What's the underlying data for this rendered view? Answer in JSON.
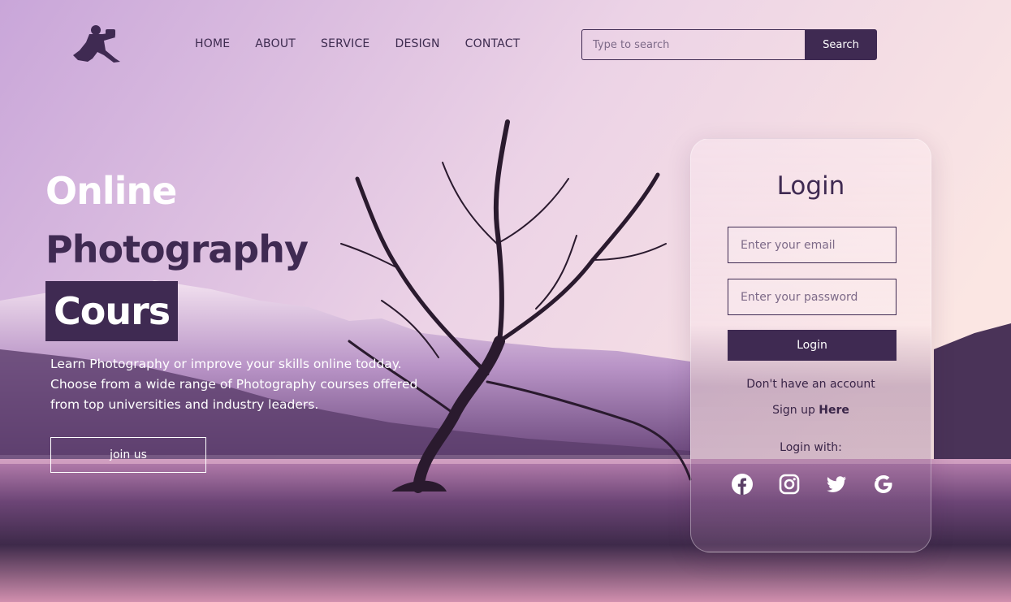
{
  "nav": {
    "items": [
      "HOME",
      "ABOUT",
      "SERVICE",
      "DESIGN",
      "CONTACT"
    ]
  },
  "search": {
    "placeholder": "Type to search",
    "button_label": "Search"
  },
  "hero": {
    "title_line1": "Online",
    "title_line2": "Photography",
    "title_line3": "Cours",
    "description": "Learn Photography or improve your skills online todday. Choose from a wide range of Photography courses offered from top universities and industry leaders.",
    "join_label": "join us"
  },
  "login": {
    "title": "Login",
    "email_placeholder": "Enter your email",
    "password_placeholder": "Enter your password",
    "button_label": "Login",
    "no_account_text": "Don't have an account",
    "signup_prefix": "Sign up",
    "signup_link": "Here",
    "login_with": "Login with:"
  },
  "socials": [
    "facebook-icon",
    "instagram-icon",
    "twitter-icon",
    "google-icon"
  ],
  "colors": {
    "accent": "#3f2a52",
    "white": "#ffffff"
  }
}
